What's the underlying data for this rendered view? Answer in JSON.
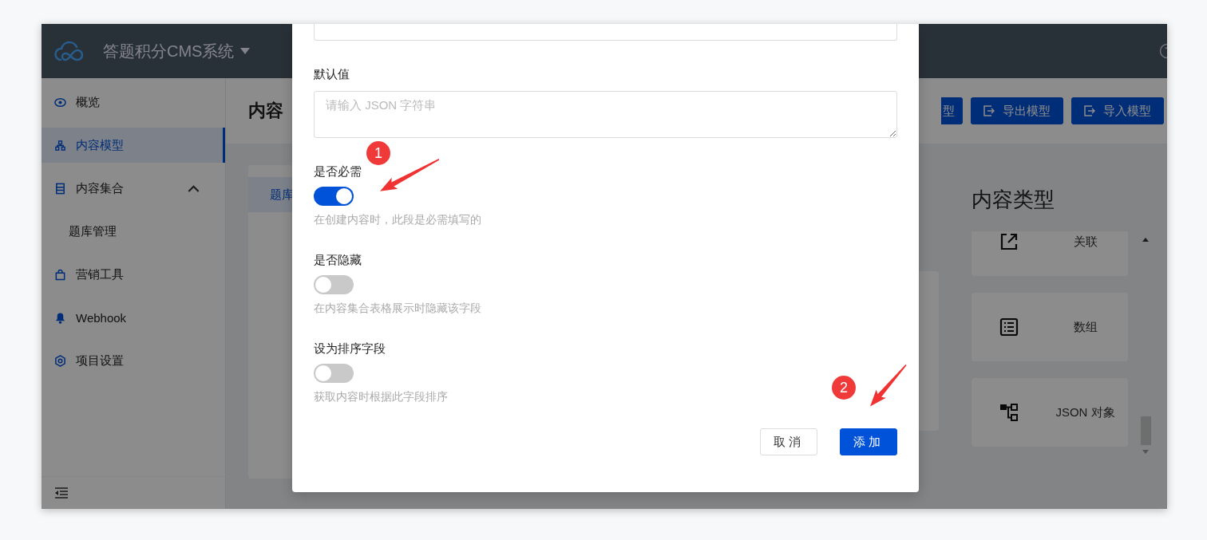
{
  "header": {
    "title": "答题积分CMS系统"
  },
  "sidebar": {
    "items": [
      {
        "label": "概览",
        "selected": false
      },
      {
        "label": "内容模型",
        "selected": true
      },
      {
        "label": "内容集合",
        "selected": false,
        "expanded": true,
        "children": [
          {
            "label": "题库管理",
            "selected": false
          }
        ]
      },
      {
        "label": "营销工具",
        "selected": false
      },
      {
        "label": "Webhook",
        "selected": false
      },
      {
        "label": "项目设置",
        "selected": false
      }
    ]
  },
  "main": {
    "title": "内容",
    "toolbar_buttons": [
      "型",
      "导出模型",
      "导入模型"
    ],
    "tabs": [
      {
        "label": "题库",
        "selected": true
      }
    ],
    "content_types": {
      "title": "内容类型",
      "items": [
        {
          "label": "关联"
        },
        {
          "label": "数组"
        },
        {
          "label": "JSON 对象"
        }
      ]
    }
  },
  "modal": {
    "fields": [
      {
        "kind": "textarea"
      },
      {
        "kind": "textarea",
        "label": "默认值",
        "placeholder": "请输入 JSON 字符串"
      },
      {
        "kind": "switch",
        "label": "是否必需",
        "on": true,
        "help": "在创建内容时，此段是必需填写的"
      },
      {
        "kind": "switch",
        "label": "是否隐藏",
        "on": false,
        "help": "在内容集合表格展示时隐藏该字段"
      },
      {
        "kind": "switch",
        "label": "设为排序字段",
        "on": false,
        "help": "获取内容时根据此字段排序"
      }
    ],
    "buttons": [
      {
        "label": "取消",
        "kind": "default"
      },
      {
        "label": "添加",
        "kind": "primary"
      }
    ]
  },
  "annotations": [
    {
      "label": "1"
    },
    {
      "label": "2"
    }
  ]
}
